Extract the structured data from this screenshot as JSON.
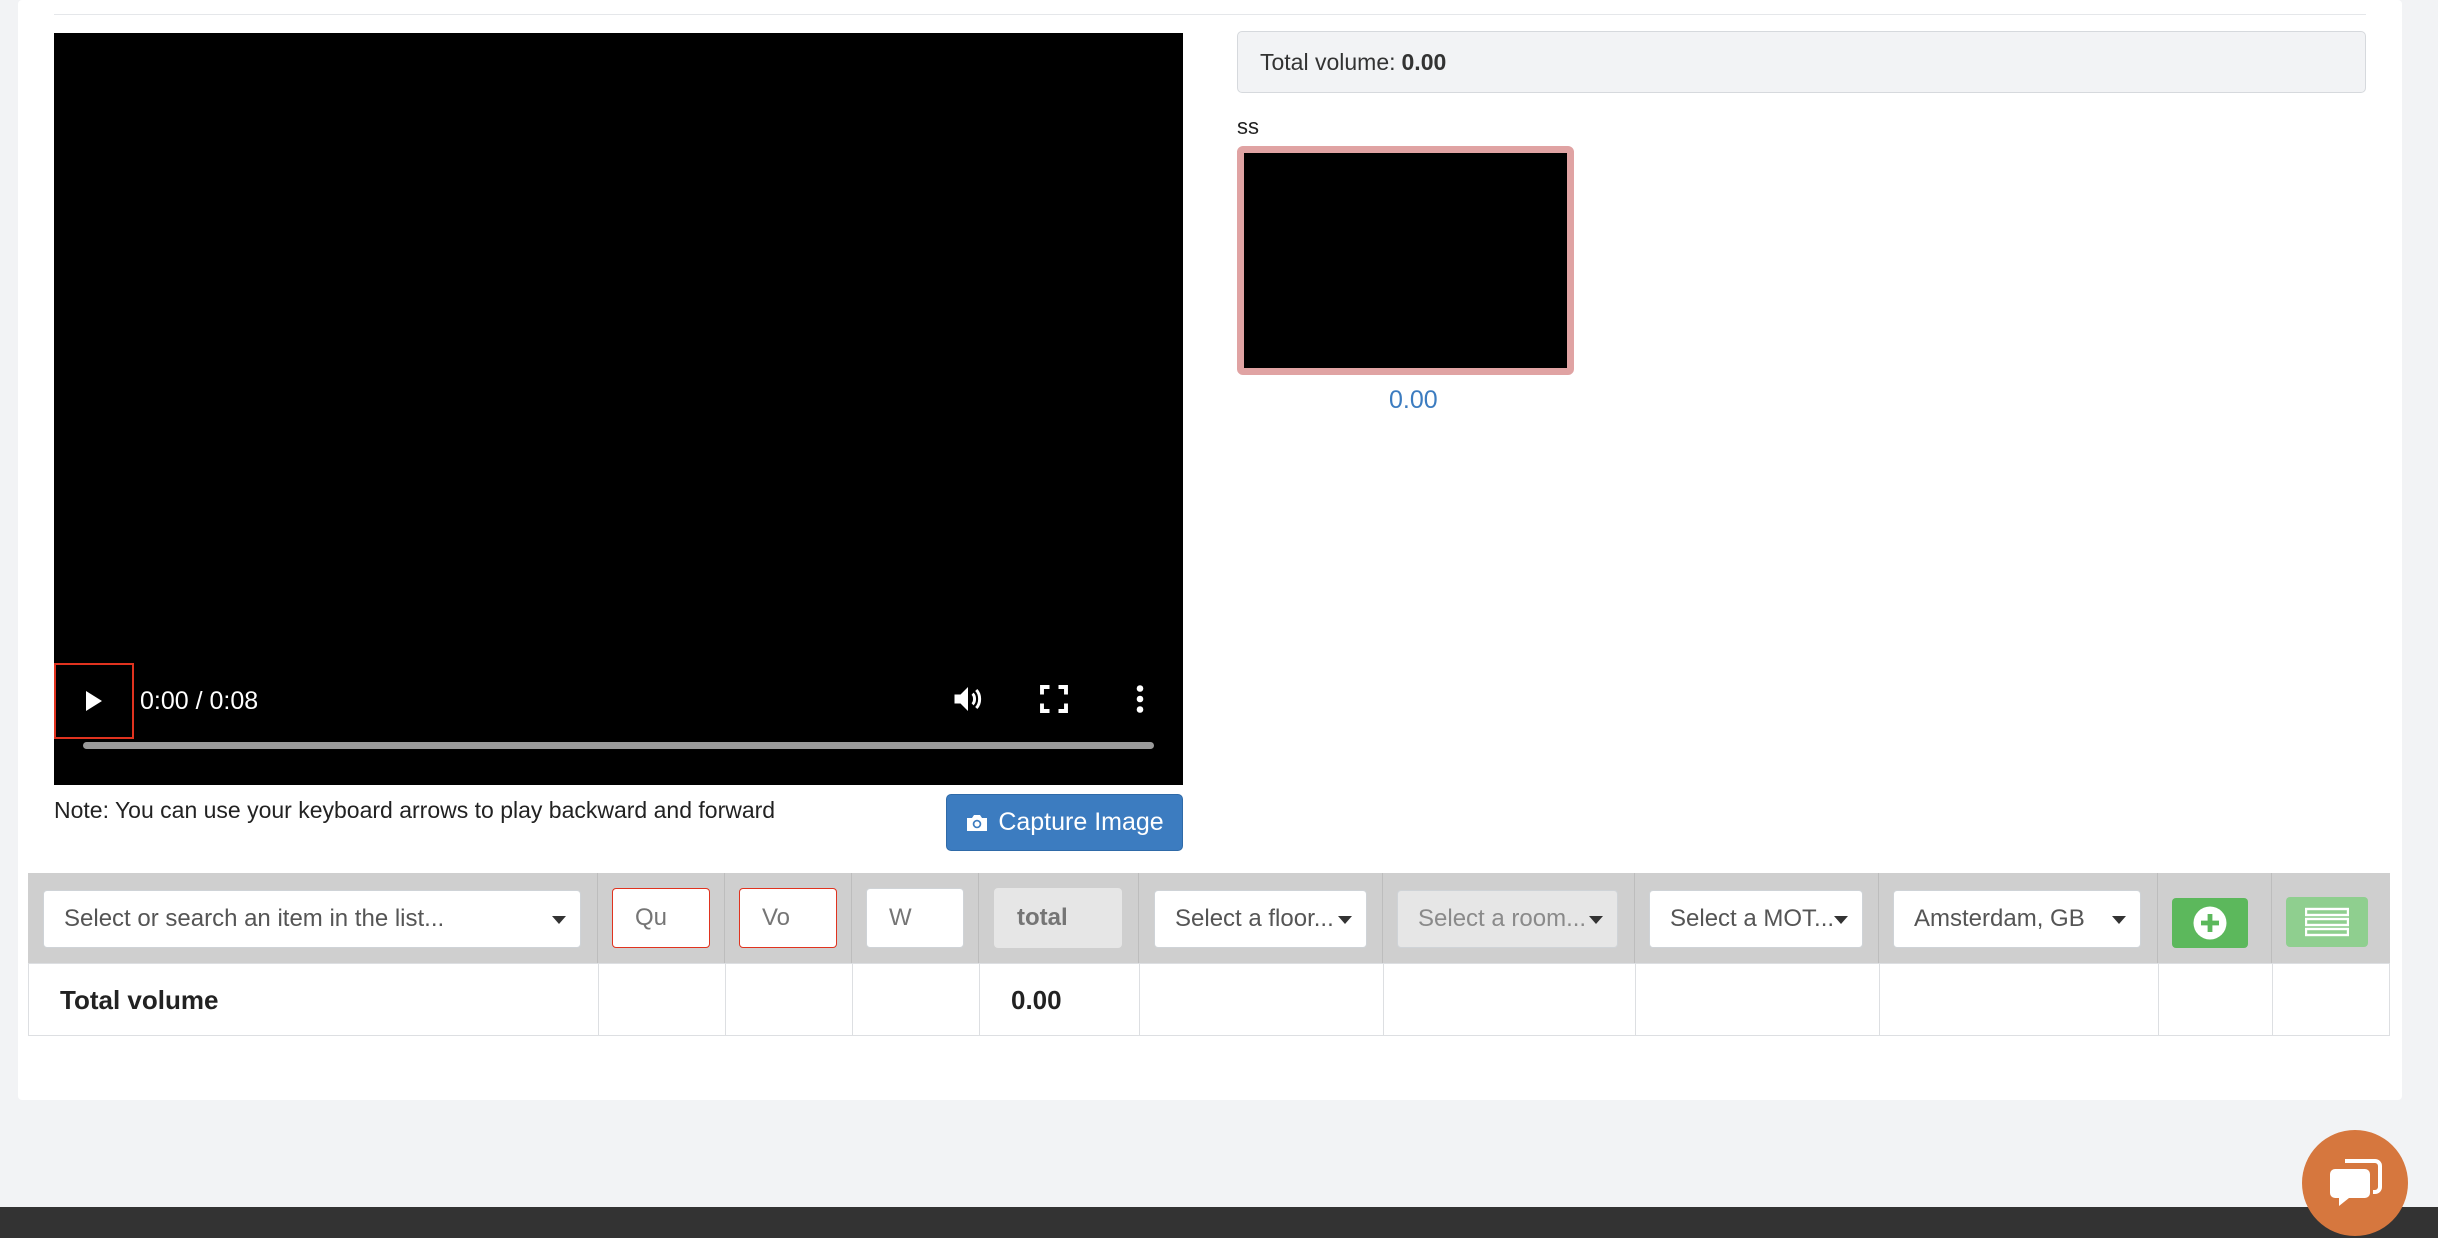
{
  "video": {
    "time": "0:00 / 0:08",
    "note": "Note: You can use your keyboard arrows to play backward and forward",
    "capture_label": "Capture Image"
  },
  "summary": {
    "total_label": "Total volume:",
    "total_value": "0.00"
  },
  "thumbnail": {
    "name": "ss",
    "value": "0.00"
  },
  "form": {
    "item_select": "Select or search an item in the list...",
    "qty_placeholder": "Qu",
    "vol_placeholder": "Vo",
    "weight_placeholder": "W",
    "total_placeholder": "total",
    "floor_select": "Select a floor...",
    "room_select": "Select a room...",
    "mot_select": "Select a MOT...",
    "location_select": "Amsterdam, GB"
  },
  "totals_row": {
    "label": "Total volume",
    "value": "0.00"
  },
  "colors": {
    "primary": "#3c7cc0",
    "success": "#5cb85c",
    "error": "#e0331f",
    "chat": "#d6773e"
  },
  "icons": [
    "play-icon",
    "volume-icon",
    "fullscreen-icon",
    "more-vert-icon",
    "camera-icon",
    "plus-circle-icon",
    "list-icon",
    "chat-icon"
  ]
}
